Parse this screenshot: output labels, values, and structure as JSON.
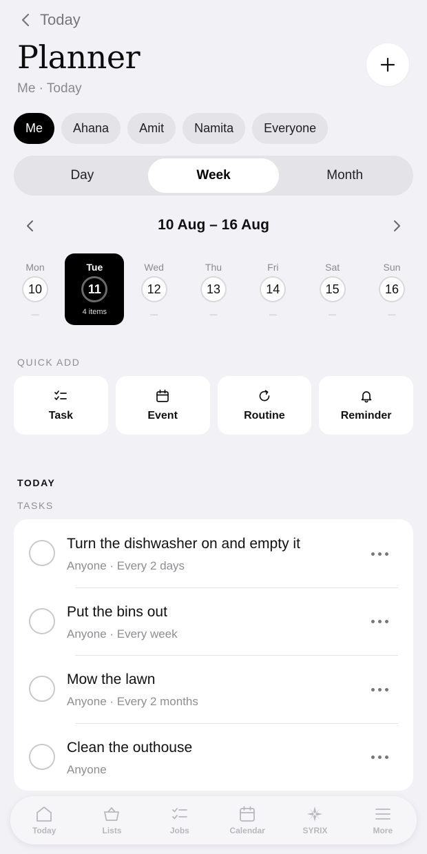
{
  "header": {
    "back_label": "Today",
    "title": "Planner",
    "subtitle": "Me · Today"
  },
  "people": [
    "Me",
    "Ahana",
    "Amit",
    "Namita",
    "Everyone"
  ],
  "views": [
    "Day",
    "Week",
    "Month"
  ],
  "range_label": "10 Aug – 16 Aug",
  "week": [
    {
      "name": "Mon",
      "num": "10",
      "meta": "—"
    },
    {
      "name": "Tue",
      "num": "11",
      "meta": "4 items"
    },
    {
      "name": "Wed",
      "num": "12",
      "meta": "—"
    },
    {
      "name": "Thu",
      "num": "13",
      "meta": "—"
    },
    {
      "name": "Fri",
      "num": "14",
      "meta": "—"
    },
    {
      "name": "Sat",
      "num": "15",
      "meta": "—"
    },
    {
      "name": "Sun",
      "num": "16",
      "meta": "—"
    }
  ],
  "quick_add": {
    "label": "QUICK ADD",
    "items": [
      {
        "label": "Task",
        "icon": "checklist-icon"
      },
      {
        "label": "Event",
        "icon": "calendar-icon"
      },
      {
        "label": "Routine",
        "icon": "refresh-icon"
      },
      {
        "label": "Reminder",
        "icon": "bell-icon"
      }
    ]
  },
  "today_label": "TODAY",
  "tasks_label": "TASKS",
  "tasks": [
    {
      "title": "Turn the dishwasher on and empty it",
      "sub": "Anyone · Every 2 days"
    },
    {
      "title": "Put the bins out",
      "sub": "Anyone · Every week"
    },
    {
      "title": "Mow the lawn",
      "sub": "Anyone · Every 2 months"
    },
    {
      "title": "Clean the outhouse",
      "sub": "Anyone"
    }
  ],
  "tabbar": [
    {
      "label": "Today",
      "icon": "home-icon"
    },
    {
      "label": "Lists",
      "icon": "basket-icon"
    },
    {
      "label": "Jobs",
      "icon": "checklist-icon"
    },
    {
      "label": "Calendar",
      "icon": "calendar-icon"
    },
    {
      "label": "SYRIX",
      "icon": "syrix-icon"
    },
    {
      "label": "More",
      "icon": "menu-icon"
    }
  ],
  "colors": {
    "background": "#f2f1f6",
    "active": "#000000",
    "chip": "#e3e3e8",
    "muted_text": "#8e8e93"
  }
}
